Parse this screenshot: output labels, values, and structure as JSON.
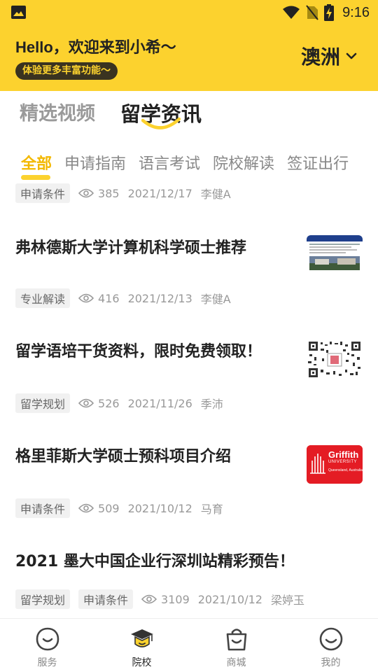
{
  "status_bar": {
    "time": "9:16"
  },
  "header": {
    "greeting": "Hello，欢迎来到小希～",
    "feature_pill": "体验更多丰富功能～",
    "region": "澳洲"
  },
  "segment_tabs": [
    {
      "label": "精选视频",
      "active": false
    },
    {
      "label": "留学资讯",
      "active": true
    }
  ],
  "category_tabs": [
    {
      "label": "全部",
      "active": true
    },
    {
      "label": "申请指南",
      "active": false
    },
    {
      "label": "语言考试",
      "active": false
    },
    {
      "label": "院校解读",
      "active": false
    },
    {
      "label": "签证出行",
      "active": false
    }
  ],
  "news": [
    {
      "title": "",
      "tags": [
        "申请条件"
      ],
      "views": "385",
      "date": "2021/12/17",
      "author": "李健A",
      "thumb": "none"
    },
    {
      "title": "弗林德斯大学计算机科学硕士推荐",
      "tags": [
        "专业解读"
      ],
      "views": "416",
      "date": "2021/12/13",
      "author": "李健A",
      "thumb": "campus-photo"
    },
    {
      "title": "留学语培干货资料，限时免费领取！",
      "tags": [
        "留学规划"
      ],
      "views": "526",
      "date": "2021/11/26",
      "author": "季沛",
      "thumb": "qr-code"
    },
    {
      "title": "格里菲斯大学硕士预科项目介绍",
      "tags": [
        "申请条件"
      ],
      "views": "509",
      "date": "2021/10/12",
      "author": "马育",
      "thumb": "griffith-logo"
    },
    {
      "title": "2021 墨大中国企业行深圳站精彩预告！",
      "tags": [
        "留学规划",
        "申请条件"
      ],
      "views": "3109",
      "date": "2021/10/12",
      "author": "梁婷玉",
      "thumb": "none"
    }
  ],
  "griffith_logo": {
    "line1": "Griffith",
    "line2": "UNIVERSITY",
    "line3": "Queensland, Australia"
  },
  "bottom_nav": [
    {
      "label": "服务",
      "icon": "smile-icon",
      "active": false
    },
    {
      "label": "院校",
      "icon": "graduation-cap-icon",
      "active": true
    },
    {
      "label": "商城",
      "icon": "shopping-bag-icon",
      "active": false
    },
    {
      "label": "我的",
      "icon": "profile-smile-icon",
      "active": false
    }
  ],
  "colors": {
    "brand_yellow": "#fcd22e",
    "accent_text": "#f3b800",
    "pill_bg": "#3a3320"
  }
}
